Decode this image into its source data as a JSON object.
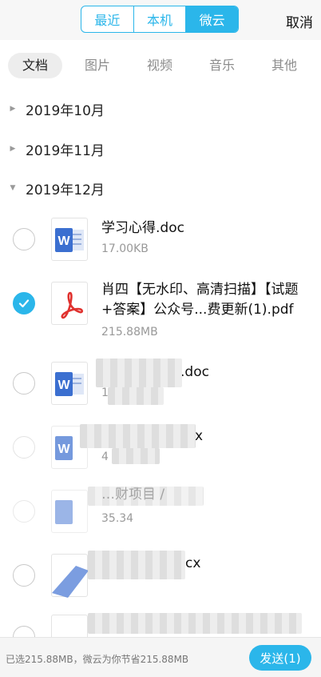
{
  "header": {
    "segments": [
      "最近",
      "本机",
      "微云"
    ],
    "active_segment": "微云",
    "cancel_label": "取消"
  },
  "categories": [
    "文档",
    "图片",
    "视频",
    "音乐",
    "其他"
  ],
  "active_category": "文档",
  "groups": [
    {
      "label": "2019年10月",
      "expanded": false
    },
    {
      "label": "2019年11月",
      "expanded": false
    },
    {
      "label": "2019年12月",
      "expanded": true
    }
  ],
  "files": [
    {
      "name": "学习心得.doc",
      "size": "17.00KB",
      "type": "word",
      "checked": false
    },
    {
      "name": "肖四【无水印、高清扫描】【试题+答案】公众号...费更新(1).pdf",
      "size": "215.88MB",
      "type": "pdf",
      "checked": true
    },
    {
      "name": ".doc",
      "size": "1",
      "type": "word",
      "checked": false
    },
    {
      "name": "x",
      "size": "4",
      "type": "word",
      "checked": false
    },
    {
      "name": "…财项目 /",
      "size": "35.34",
      "type": "word",
      "checked": false
    },
    {
      "name": "cx",
      "size": "",
      "type": "word",
      "checked": false
    },
    {
      "name": "",
      "size": "",
      "type": "word",
      "checked": false
    }
  ],
  "footer": {
    "info": "已选215.88MB，微云为你节省215.88MB",
    "send_label": "发送(1)"
  },
  "colors": {
    "accent": "#2bb6ea",
    "word_blue": "#3b6fd0",
    "pdf_red": "#e0322f"
  }
}
